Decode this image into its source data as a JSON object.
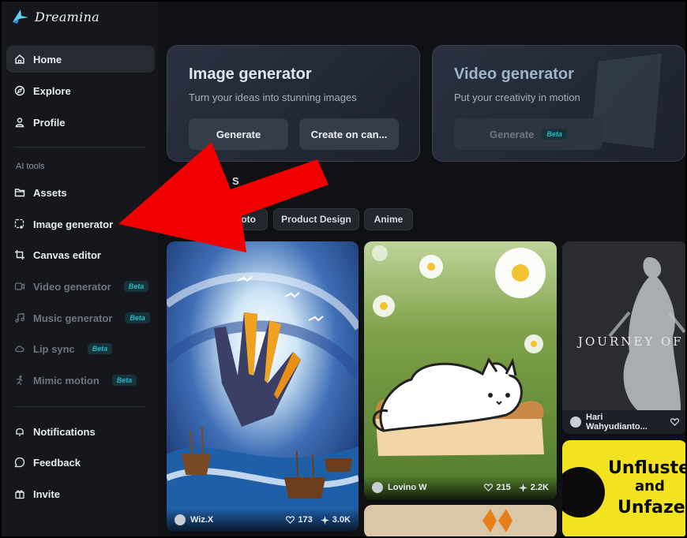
{
  "app": {
    "brand": "Dreamina"
  },
  "sidebar": {
    "items": [
      {
        "label": "Home",
        "icon": "home-icon"
      },
      {
        "label": "Explore",
        "icon": "compass-icon"
      },
      {
        "label": "Profile",
        "icon": "user-icon"
      }
    ],
    "section_label": "AI tools",
    "tools": [
      {
        "label": "Assets",
        "icon": "folder-icon"
      },
      {
        "label": "Image generator",
        "icon": "image-plus-icon"
      },
      {
        "label": "Canvas editor",
        "icon": "crop-icon"
      },
      {
        "label": "Video generator",
        "badge": "Beta",
        "icon": "video-icon"
      },
      {
        "label": "Music generator",
        "badge": "Beta",
        "icon": "music-icon"
      },
      {
        "label": "Lip sync",
        "badge": "Beta",
        "icon": "cloud-icon"
      },
      {
        "label": "Mimic motion",
        "badge": "Beta",
        "icon": "figure-icon"
      }
    ],
    "bottom": [
      {
        "label": "Notifications",
        "icon": "bell-icon"
      },
      {
        "label": "Feedback",
        "icon": "chat-icon"
      },
      {
        "label": "Invite",
        "icon": "gift-icon"
      }
    ]
  },
  "cards": {
    "image": {
      "title": "Image generator",
      "subtitle": "Turn your ideas into stunning images",
      "btn1": "Generate",
      "btn2": "Create on can..."
    },
    "video": {
      "title": "Video generator",
      "subtitle": "Put your creativity in motion",
      "btn": "Generate",
      "badge": "Beta"
    }
  },
  "section_partial": "S",
  "filters": [
    "Photo",
    "Product Design",
    "Anime"
  ],
  "gallery": [
    {
      "author": "Wiz.X",
      "likes": "173",
      "remixes": "3.0K"
    },
    {
      "author": "Lovino W",
      "likes": "215",
      "remixes": "2.2K"
    },
    {
      "author": "Hari Wahyudianto...",
      "poster_text": "JOURNEY OF"
    },
    {
      "poster_text_1": "Unfluste",
      "poster_text_2": "and",
      "poster_text_3": "Unfaze"
    }
  ],
  "colors": {
    "accent_beta": "#27b9c2",
    "arrow": "#f00000",
    "background": "#0f1115"
  }
}
